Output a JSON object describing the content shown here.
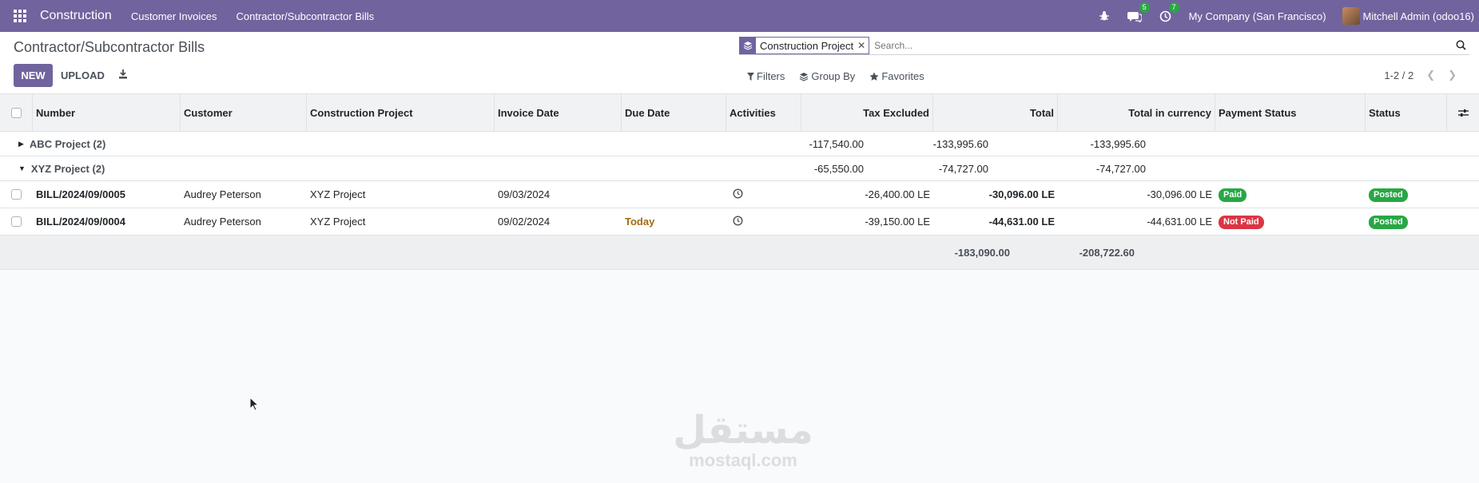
{
  "navbar": {
    "brand": "Construction",
    "menu": [
      "Customer Invoices",
      "Contractor/Subcontractor Bills"
    ],
    "messages_count": "5",
    "activities_count": "7",
    "company": "My Company (San Francisco)",
    "user": "Mitchell Admin (odoo16)",
    "bg_color": "#71639e"
  },
  "control": {
    "title": "Contractor/Subcontractor Bills",
    "new_label": "NEW",
    "upload_label": "UPLOAD",
    "facet_label": "Construction Project",
    "search_placeholder": "Search...",
    "filters_label": "Filters",
    "groupby_label": "Group By",
    "favorites_label": "Favorites",
    "pager": "1-2 / 2"
  },
  "table": {
    "headers": {
      "number": "Number",
      "customer": "Customer",
      "project": "Construction Project",
      "invoice_date": "Invoice Date",
      "due_date": "Due Date",
      "activities": "Activities",
      "tax_excluded": "Tax Excluded",
      "total": "Total",
      "total_currency": "Total in currency",
      "payment_status": "Payment Status",
      "status": "Status"
    },
    "groups": [
      {
        "label": "ABC Project (2)",
        "tax_excluded": "-117,540.00",
        "total": "-133,995.60",
        "total_currency": "-133,995.60",
        "expanded": false
      },
      {
        "label": "XYZ Project (2)",
        "tax_excluded": "-65,550.00",
        "total": "-74,727.00",
        "total_currency": "-74,727.00",
        "expanded": true
      }
    ],
    "rows": [
      {
        "number": "BILL/2024/09/0005",
        "customer": "Audrey Peterson",
        "project": "XYZ Project",
        "invoice_date": "09/03/2024",
        "due_date": "",
        "tax_excluded": "-26,400.00 LE",
        "total": "-30,096.00 LE",
        "total_currency": "-30,096.00 LE",
        "payment_status": "Paid",
        "status": "Posted"
      },
      {
        "number": "BILL/2024/09/0004",
        "customer": "Audrey Peterson",
        "project": "XYZ Project",
        "invoice_date": "09/02/2024",
        "due_date": "Today",
        "tax_excluded": "-39,150.00 LE",
        "total": "-44,631.00 LE",
        "total_currency": "-44,631.00 LE",
        "payment_status": "Not Paid",
        "status": "Posted"
      }
    ],
    "totals": {
      "tax_excluded": "-183,090.00",
      "total": "-208,722.60"
    }
  },
  "watermark": {
    "arabic": "مستقل",
    "latin": "mostaql.com"
  }
}
